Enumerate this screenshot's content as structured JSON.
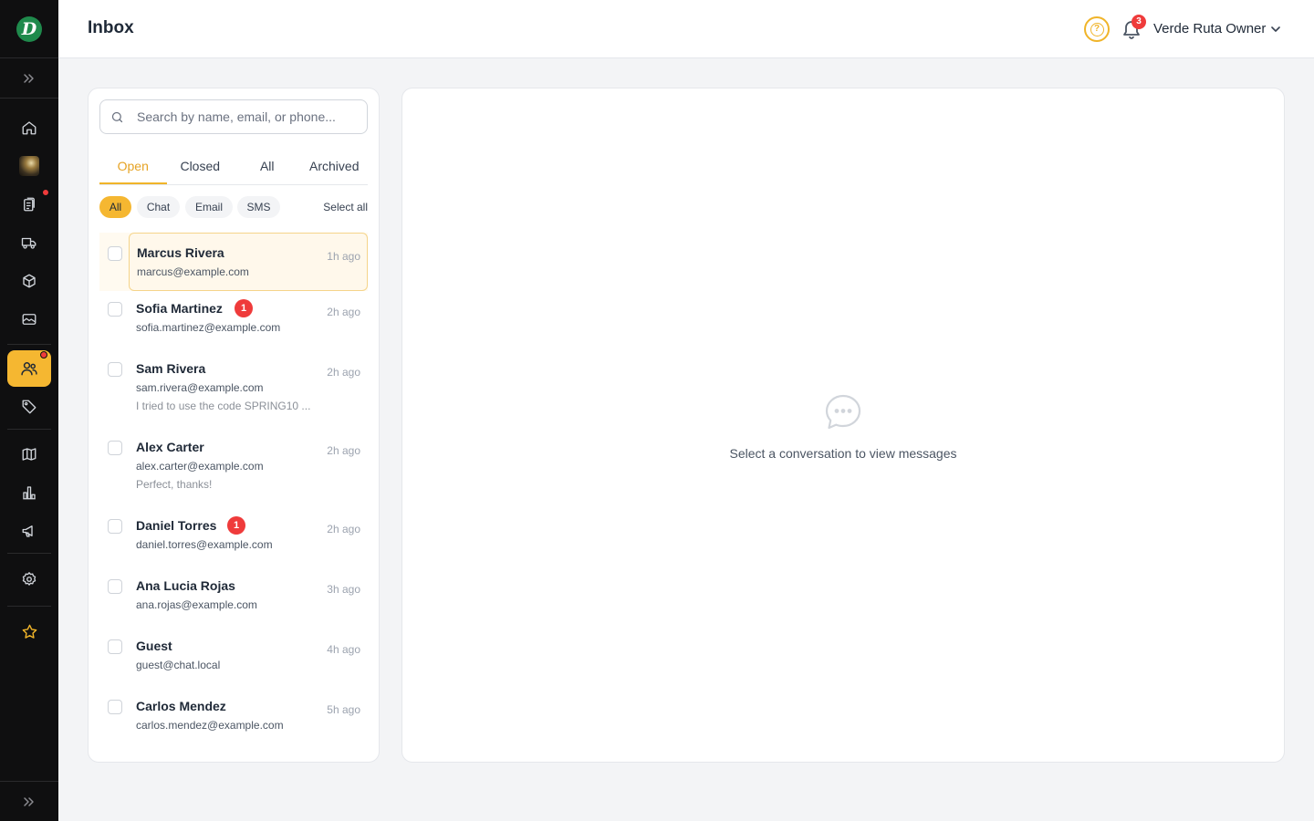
{
  "header": {
    "title": "Inbox",
    "notifications_count": "3",
    "user_name": "Verde Ruta Owner"
  },
  "sidebar": {
    "logo_letter": "D",
    "items": [
      {
        "icon": "home-icon"
      },
      {
        "icon": "avatar-thumbnail"
      },
      {
        "icon": "clipboard-icon",
        "dot": true
      },
      {
        "icon": "truck-icon"
      },
      {
        "icon": "box-icon"
      },
      {
        "icon": "image-icon"
      },
      {
        "icon": "users-icon",
        "active": true,
        "dot": true
      },
      {
        "icon": "tag-icon"
      },
      {
        "icon": "map-icon"
      },
      {
        "icon": "bar-chart-icon"
      },
      {
        "icon": "megaphone-icon"
      },
      {
        "icon": "gear-icon"
      },
      {
        "icon": "star-icon"
      }
    ]
  },
  "search": {
    "placeholder": "Search by name, email, or phone..."
  },
  "tabs": [
    "Open",
    "Closed",
    "All",
    "Archived"
  ],
  "active_tab": "Open",
  "filters": [
    "All",
    "Chat",
    "Email",
    "SMS"
  ],
  "active_filter": "All",
  "select_all_label": "Select all",
  "conversations": [
    {
      "name": "Marcus Rivera",
      "email": "marcus@example.com",
      "preview": "",
      "time": "1h ago",
      "unread": "",
      "selected": true
    },
    {
      "name": "Sofia Martinez",
      "email": "sofia.martinez@example.com",
      "preview": "",
      "time": "2h ago",
      "unread": "1"
    },
    {
      "name": "Sam Rivera",
      "email": "sam.rivera@example.com",
      "preview": "I tried to use the code SPRING10 ...",
      "time": "2h ago",
      "unread": ""
    },
    {
      "name": "Alex Carter",
      "email": "alex.carter@example.com",
      "preview": "Perfect, thanks!",
      "time": "2h ago",
      "unread": ""
    },
    {
      "name": "Daniel Torres",
      "email": "daniel.torres@example.com",
      "preview": "",
      "time": "2h ago",
      "unread": "1"
    },
    {
      "name": "Ana Lucia Rojas",
      "email": "ana.rojas@example.com",
      "preview": "",
      "time": "3h ago",
      "unread": ""
    },
    {
      "name": "Guest",
      "email": "guest@chat.local",
      "preview": "",
      "time": "4h ago",
      "unread": ""
    },
    {
      "name": "Carlos Mendez",
      "email": "carlos.mendez@example.com",
      "preview": "",
      "time": "5h ago",
      "unread": ""
    }
  ],
  "message_panel": {
    "empty_text": "Select a conversation to view messages"
  },
  "colors": {
    "accent": "#f5b731",
    "sidebar_bg": "#0f0f10",
    "badge_red": "#ef3b3b"
  }
}
